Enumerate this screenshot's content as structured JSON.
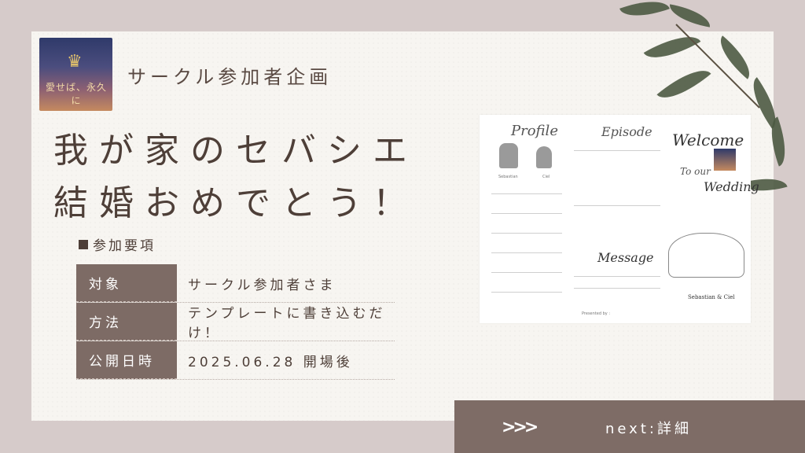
{
  "header": {
    "logo_text": "愛せば、永久に",
    "subtitle": "サークル参加者企画"
  },
  "title": {
    "line1": "我が家のセバシエ",
    "line2": "結婚おめでとう！"
  },
  "section": {
    "heading": "参加要項"
  },
  "details": [
    {
      "label": "対象",
      "value": "サークル参加者さま"
    },
    {
      "label": "方法",
      "value": "テンプレートに書き込むだけ！"
    },
    {
      "label": "公開日時",
      "value": "2025.06.28 開場後"
    }
  ],
  "preview": {
    "profile": "Profile",
    "episode": "Episode",
    "welcome": "Welcome",
    "to_our": "To our",
    "wedding": "Wedding",
    "message": "Message",
    "names": "Sebastian & Ciel",
    "name_left": "Sebastian",
    "name_right": "Ciel",
    "presented_by": "Presented by :"
  },
  "footer": {
    "arrows": ">>>",
    "next_label": "next:詳細"
  },
  "colors": {
    "background": "#d6cbca",
    "accent": "#7e6c66",
    "text": "#4e3f38"
  }
}
